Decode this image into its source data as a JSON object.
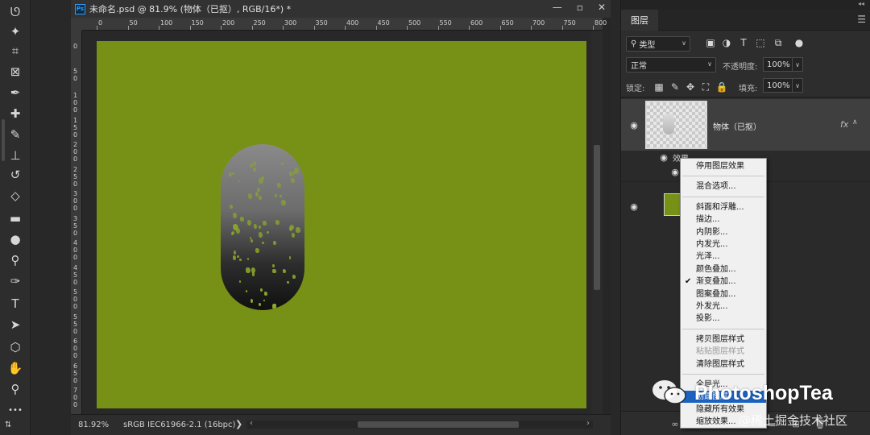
{
  "document": {
    "title": "未命名.psd @ 81.9% (物体（已抠）, RGB/16*) *",
    "ps_icon": "Ps",
    "window_controls": [
      "minimize-icon",
      "restore-icon",
      "close-icon"
    ],
    "ruler_h": [
      "0",
      "50",
      "100",
      "150",
      "200",
      "250",
      "300",
      "350",
      "400",
      "450",
      "500",
      "550",
      "600",
      "650",
      "700",
      "750",
      "800"
    ],
    "ruler_v": [
      "0",
      "50",
      "100",
      "150",
      "200",
      "250",
      "300",
      "350",
      "400",
      "450",
      "500",
      "550",
      "600",
      "650",
      "700",
      "750"
    ],
    "canvas_color": "#779116",
    "status": {
      "zoom": "81.92%",
      "profile": "sRGB IEC61966-2.1 (16bpc)",
      "arrow": "❯"
    }
  },
  "tools": [
    "lasso-icon",
    "magic-wand-icon",
    "crop-icon",
    "frame-icon",
    "eyedropper-icon",
    "healing-brush-icon",
    "brush-icon",
    "clone-stamp-icon",
    "history-brush-icon",
    "eraser-icon",
    "gradient-icon",
    "blur-icon",
    "dodge-icon",
    "pen-icon",
    "type-icon",
    "path-select-icon",
    "shape-icon",
    "hand-icon",
    "zoom-icon",
    "more-tools-icon"
  ],
  "layers_panel": {
    "tab": "图层",
    "filter_kind": "类型",
    "blend_mode": "正常",
    "opacity_label": "不透明度:",
    "opacity_value": "100%",
    "lock_label": "锁定:",
    "fill_label": "填充:",
    "fill_value": "100%",
    "layers": [
      {
        "name": "物体（已抠）",
        "fx": "fx",
        "effects_label": "效果"
      },
      {
        "name": ""
      }
    ]
  },
  "context_menu": {
    "items": [
      {
        "label": "停用图层效果",
        "disabled": false
      },
      {
        "separator": true
      },
      {
        "label": "混合选项...",
        "disabled": false
      },
      {
        "separator": true
      },
      {
        "label": "斜面和浮雕...",
        "disabled": false
      },
      {
        "label": "描边...",
        "disabled": false
      },
      {
        "label": "内阴影...",
        "disabled": false
      },
      {
        "label": "内发光...",
        "disabled": false
      },
      {
        "label": "光泽...",
        "disabled": false
      },
      {
        "label": "颜色叠加...",
        "disabled": false
      },
      {
        "label": "渐变叠加...",
        "disabled": false,
        "checked": true
      },
      {
        "label": "图案叠加...",
        "disabled": false
      },
      {
        "label": "外发光...",
        "disabled": false
      },
      {
        "label": "投影...",
        "disabled": false
      },
      {
        "separator": true
      },
      {
        "label": "拷贝图层样式",
        "disabled": false
      },
      {
        "label": "粘贴图层样式",
        "disabled": true
      },
      {
        "label": "清除图层样式",
        "disabled": false
      },
      {
        "separator": true
      },
      {
        "label": "全局光...",
        "disabled": false
      },
      {
        "label": "创建图层",
        "disabled": false,
        "highlighted": true
      },
      {
        "label": "隐藏所有效果",
        "disabled": false
      },
      {
        "label": "缩放效果...",
        "disabled": false
      }
    ],
    "check_mark": "✔"
  },
  "watermark": {
    "brand": "PhotoshopTea",
    "sub": "@稀土掘金技术社区"
  }
}
